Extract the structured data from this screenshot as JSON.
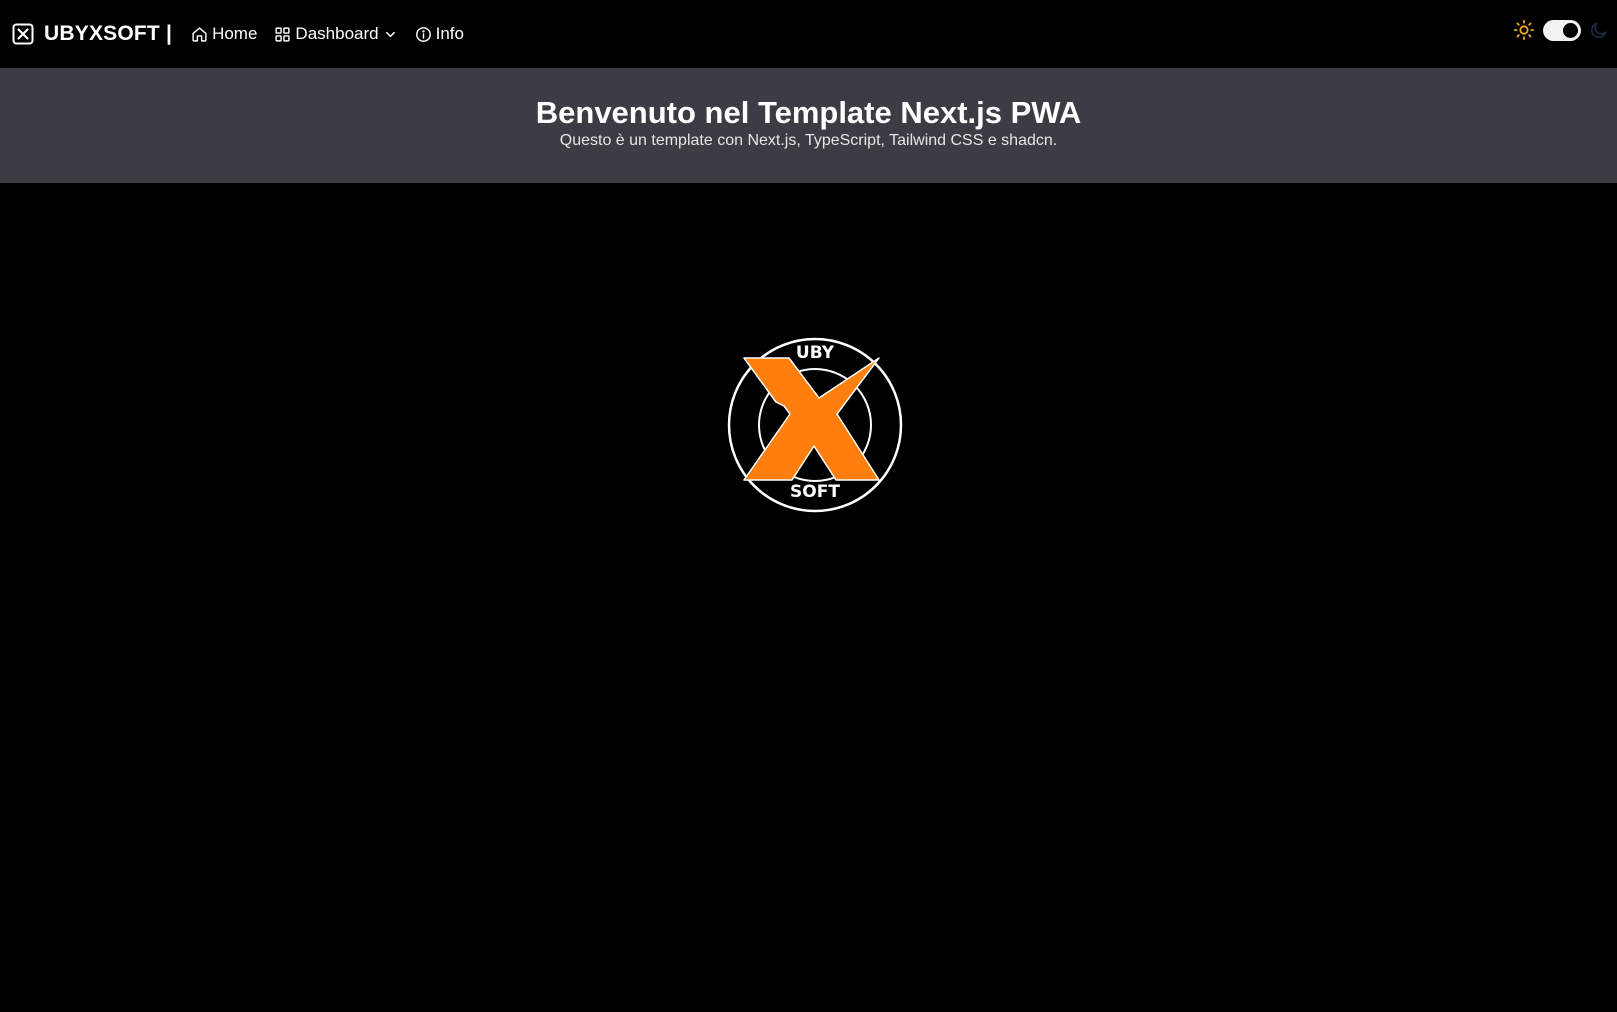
{
  "navbar": {
    "brand": {
      "icon": "x-square-icon",
      "label": "UBYXSOFT |"
    },
    "links": [
      {
        "label": "Home",
        "icon": "home-icon"
      },
      {
        "label": "Dashboard",
        "icon": "grid-icon",
        "dropdown_icon": "chevron-down-icon"
      },
      {
        "label": "Info",
        "icon": "info-icon"
      }
    ],
    "theme_toggle": {
      "left_icon": "sun-icon",
      "right_icon": "moon-icon",
      "state": "dark"
    }
  },
  "hero": {
    "title": "Benvenuto nel Template Next.js PWA",
    "subtitle": "Questo è un template con Next.js, TypeScript, Tailwind CSS e shadcn."
  },
  "logo": {
    "top_text": "UBY",
    "bottom_text": "SOFT",
    "accent_color": "#ff7f0e"
  },
  "colors": {
    "background": "#000000",
    "hero_background": "#3b3c44",
    "sun": "#f5a623",
    "moon": "#1f2a44"
  }
}
